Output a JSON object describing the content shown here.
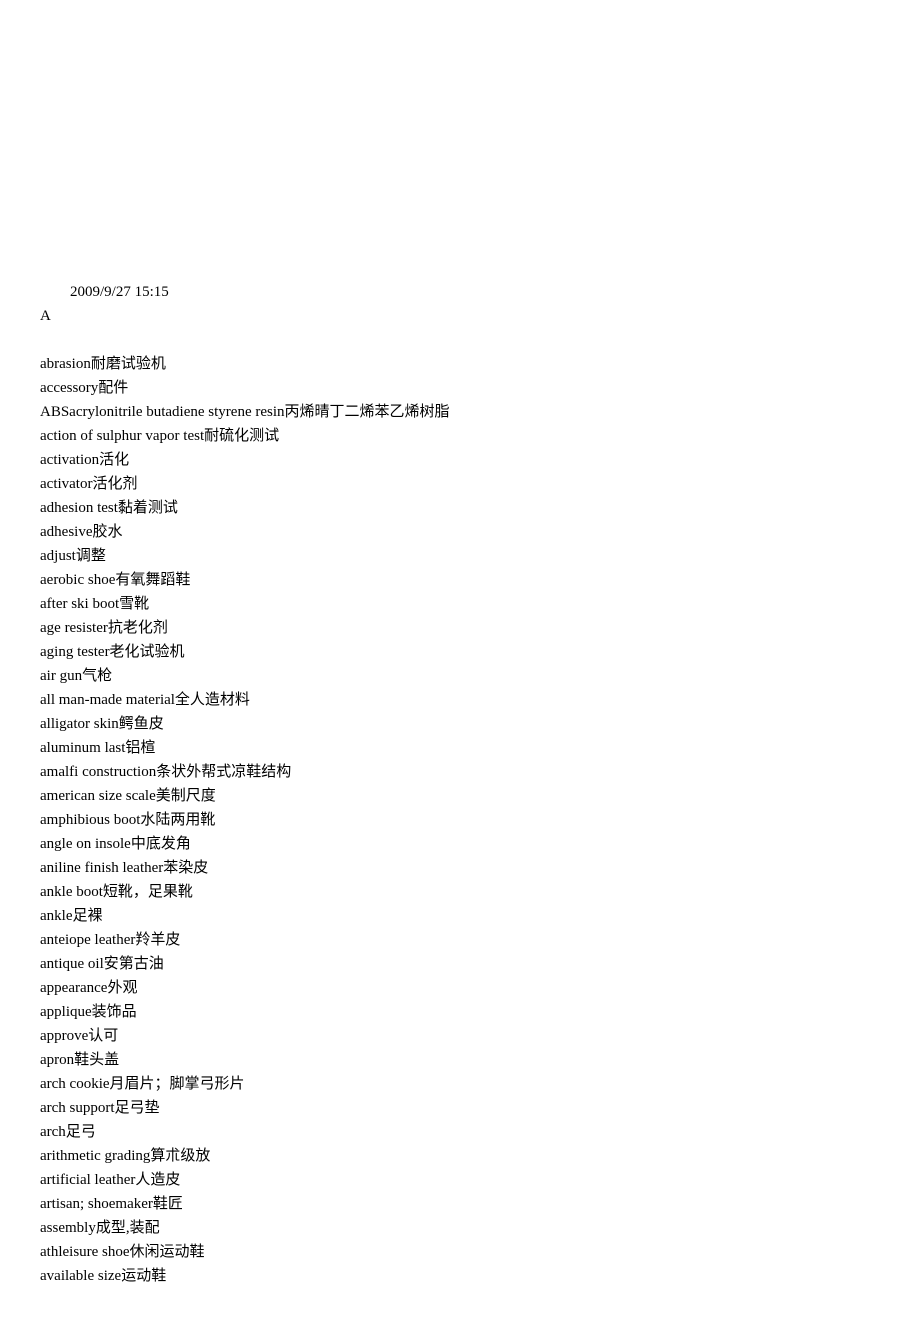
{
  "timestamp": "2009/9/27 15:15",
  "section_letter": "A",
  "entries": [
    "abrasion耐磨试验机",
    "accessory配件",
    "ABSacrylonitrile butadiene styrene resin丙烯晴丁二烯苯乙烯树脂",
    "action of sulphur vapor test耐硫化测试",
    "activation活化",
    "activator活化剂",
    "adhesion test黏着测试",
    "adhesive胶水",
    "adjust调整",
    "aerobic shoe有氧舞蹈鞋",
    "after ski boot雪靴",
    "age resister抗老化剂",
    "aging tester老化试验机",
    "air gun气枪",
    "all man-made material全人造材料",
    "alligator skin鳄鱼皮",
    "aluminum last铝楦",
    "amalfi construction条状外帮式凉鞋结构",
    "american size scale美制尺度",
    "amphibious boot水陆两用靴",
    "angle on insole中底发角",
    "aniline finish leather苯染皮",
    "ankle boot短靴，足果靴",
    "ankle足裸",
    "anteiope leather羚羊皮",
    "antique oil安第古油",
    "appearance外观",
    "applique装饰品",
    "approve认可",
    "apron鞋头盖",
    "arch cookie月眉片；脚掌弓形片",
    "arch support足弓垫",
    "arch足弓",
    "arithmetic grading算朮级放",
    "artificial leather人造皮",
    "artisan; shoemaker鞋匠",
    "assembly成型,装配",
    "athleisure shoe休闲运动鞋",
    "available size运动鞋"
  ]
}
